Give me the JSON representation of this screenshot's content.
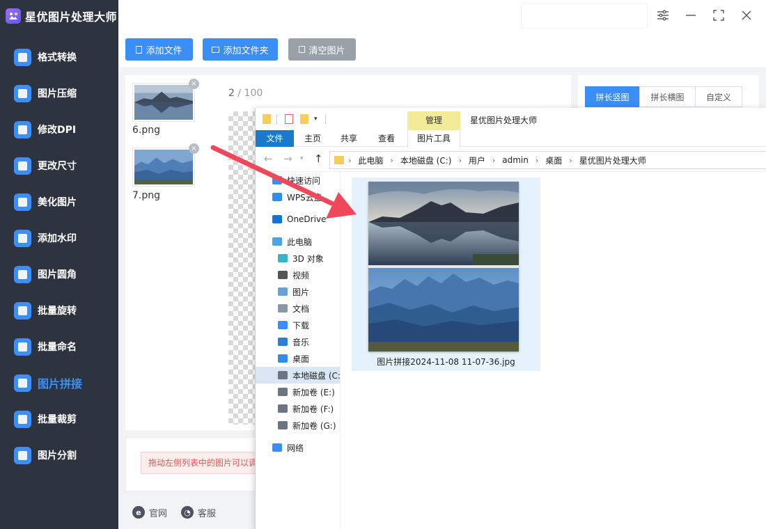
{
  "app": {
    "title": "星优图片处理大师"
  },
  "sidebar": {
    "items": [
      {
        "label": "格式转换",
        "icon": "image-convert-icon",
        "color": "#3d8ff7"
      },
      {
        "label": "图片压缩",
        "icon": "image-compress-icon",
        "color": "#3d8ff7"
      },
      {
        "label": "修改DPI",
        "icon": "dpi-icon",
        "color": "#3d8ff7"
      },
      {
        "label": "更改尺寸",
        "icon": "resize-icon",
        "color": "#3d8ff7"
      },
      {
        "label": "美化图片",
        "icon": "beautify-icon",
        "color": "#3d8ff7"
      },
      {
        "label": "添加水印",
        "icon": "watermark-icon",
        "color": "#3d8ff7"
      },
      {
        "label": "图片圆角",
        "icon": "rounded-corner-icon",
        "color": "#3d8ff7"
      },
      {
        "label": "批量旋转",
        "icon": "rotate-icon",
        "color": "#3d8ff7"
      },
      {
        "label": "批量命名",
        "icon": "rename-icon",
        "color": "#3d8ff7"
      },
      {
        "label": "图片拼接",
        "icon": "stitch-icon",
        "color": "#3d8ff7",
        "active": true
      },
      {
        "label": "批量裁剪",
        "icon": "crop-icon",
        "color": "#3d8ff7"
      },
      {
        "label": "图片分割",
        "icon": "split-icon",
        "color": "#3d8ff7"
      }
    ]
  },
  "toolbar": {
    "add_file": "添加文件",
    "add_folder": "添加文件夹",
    "clear": "清空图片"
  },
  "files": [
    {
      "name": "6.png"
    },
    {
      "name": "7.png"
    }
  ],
  "counter": {
    "current": "2",
    "total": " / 100"
  },
  "hint": "拖动左侧列表中的图片可以调",
  "footer": {
    "website": "官网",
    "support": "客服"
  },
  "layout_tabs": [
    {
      "label": "拼长竖图",
      "active": true
    },
    {
      "label": "拼长横图"
    },
    {
      "label": "自定义"
    }
  ],
  "explorer": {
    "context_tab": "管理",
    "window_title": "星优图片处理大师",
    "ribbon_tabs": [
      "文件",
      "主页",
      "共享",
      "查看",
      "图片工具"
    ],
    "breadcrumb": [
      "此电脑",
      "本地磁盘 (C:)",
      "用户",
      "admin",
      "桌面",
      "星优图片处理大师"
    ],
    "nav": [
      {
        "label": "快速访问",
        "icon": "star-icon"
      },
      {
        "label": "WPS云盘",
        "icon": "cloud-icon"
      },
      {
        "label": "OneDrive",
        "icon": "onedrive-icon"
      },
      {
        "label": "此电脑",
        "icon": "computer-icon"
      },
      {
        "label": "3D 对象",
        "icon": "cube-icon"
      },
      {
        "label": "视频",
        "icon": "video-icon"
      },
      {
        "label": "图片",
        "icon": "picture-icon"
      },
      {
        "label": "文档",
        "icon": "document-icon"
      },
      {
        "label": "下载",
        "icon": "download-icon"
      },
      {
        "label": "音乐",
        "icon": "music-icon"
      },
      {
        "label": "桌面",
        "icon": "desktop-icon"
      },
      {
        "label": "本地磁盘 (C:",
        "icon": "drive-c-icon",
        "selected": true
      },
      {
        "label": "新加卷 (E:)",
        "icon": "drive-icon"
      },
      {
        "label": "新加卷 (F:)",
        "icon": "drive-icon"
      },
      {
        "label": "新加卷 (G:)",
        "icon": "drive-icon"
      },
      {
        "label": "网络",
        "icon": "network-icon"
      }
    ],
    "file": {
      "name": "图片拼接2024-11-08 11-07-36.jpg"
    }
  },
  "colors": {
    "sidebar_bg": "#2d3440",
    "accent": "#3a8ef6",
    "arrow": "#f0485a"
  }
}
